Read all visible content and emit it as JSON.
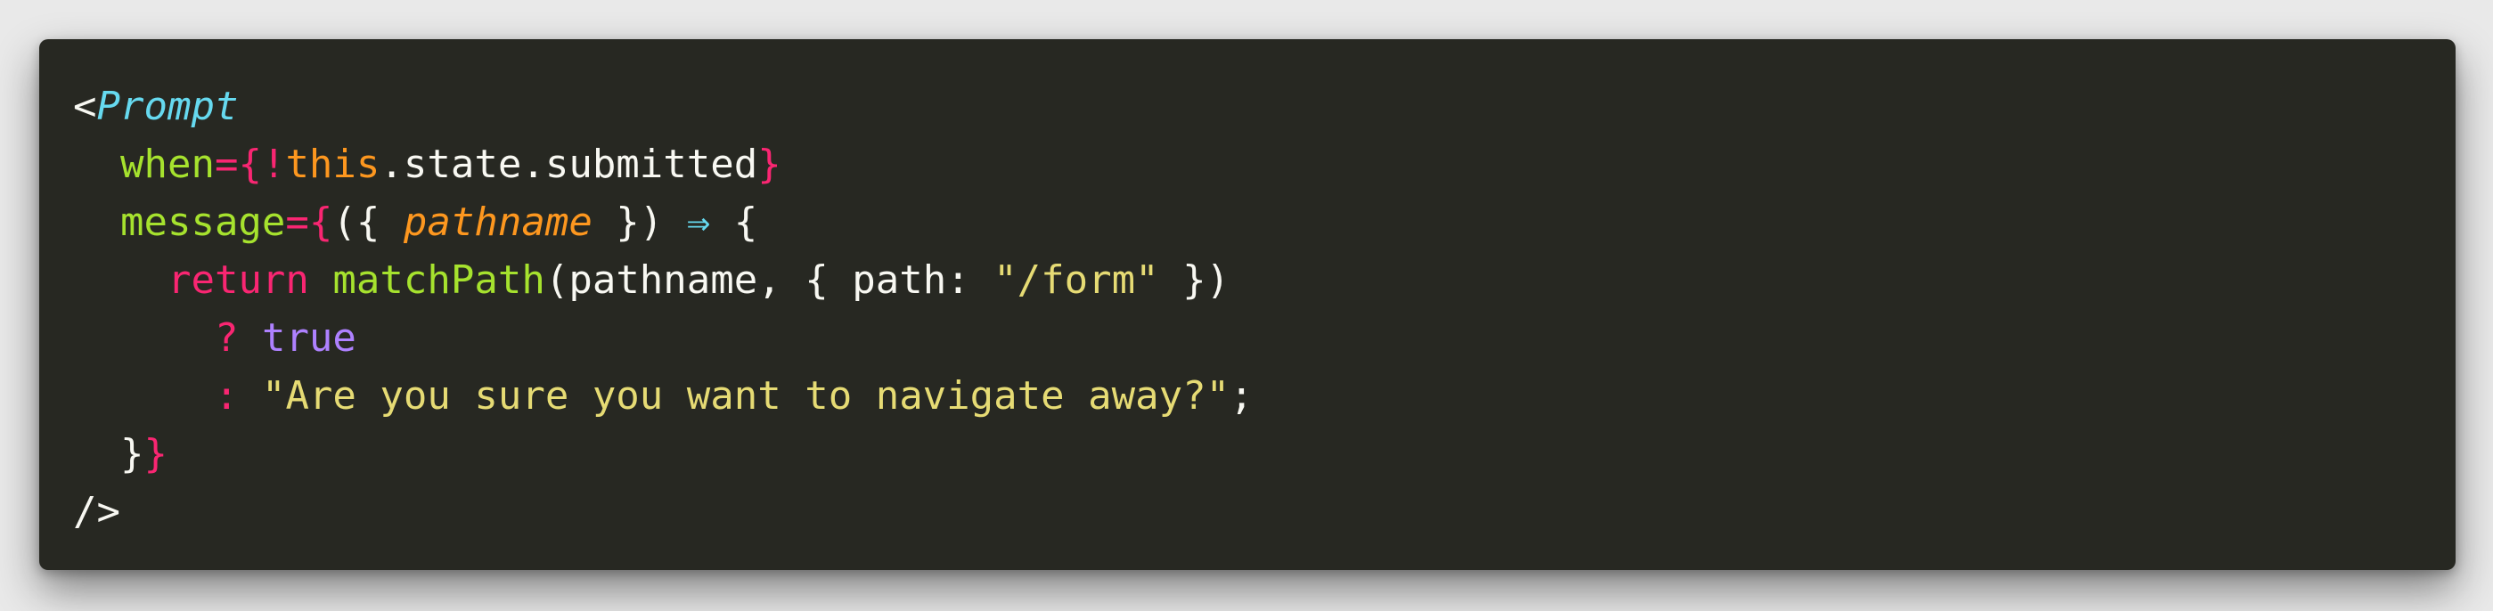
{
  "code": {
    "lines": [
      [
        {
          "t": "<",
          "c": "plain"
        },
        {
          "t": "Prompt",
          "c": "tag"
        }
      ],
      [
        {
          "t": "  ",
          "c": "plain"
        },
        {
          "t": "when",
          "c": "attr"
        },
        {
          "t": "={",
          "c": "op"
        },
        {
          "t": "!",
          "c": "op"
        },
        {
          "t": "this",
          "c": "kw-this"
        },
        {
          "t": ".state.submitted",
          "c": "plain"
        },
        {
          "t": "}",
          "c": "op"
        }
      ],
      [
        {
          "t": "  ",
          "c": "plain"
        },
        {
          "t": "message",
          "c": "attr"
        },
        {
          "t": "={",
          "c": "op"
        },
        {
          "t": "({ ",
          "c": "plain"
        },
        {
          "t": "pathname",
          "c": "param"
        },
        {
          "t": " }) ",
          "c": "plain"
        },
        {
          "t": "⇒",
          "c": "arrow"
        },
        {
          "t": " {",
          "c": "plain"
        }
      ],
      [
        {
          "t": "    ",
          "c": "plain"
        },
        {
          "t": "return",
          "c": "kw"
        },
        {
          "t": " ",
          "c": "plain"
        },
        {
          "t": "matchPath",
          "c": "fn"
        },
        {
          "t": "(pathname, { path: ",
          "c": "plain"
        },
        {
          "t": "\"/form\"",
          "c": "str"
        },
        {
          "t": " })",
          "c": "plain"
        }
      ],
      [
        {
          "t": "      ",
          "c": "plain"
        },
        {
          "t": "?",
          "c": "op"
        },
        {
          "t": " ",
          "c": "plain"
        },
        {
          "t": "true",
          "c": "bool"
        }
      ],
      [
        {
          "t": "      ",
          "c": "plain"
        },
        {
          "t": ":",
          "c": "op"
        },
        {
          "t": " ",
          "c": "plain"
        },
        {
          "t": "\"Are you sure you want to navigate away?\"",
          "c": "str"
        },
        {
          "t": ";",
          "c": "plain"
        }
      ],
      [
        {
          "t": "  ",
          "c": "plain"
        },
        {
          "t": "}",
          "c": "plain"
        },
        {
          "t": "}",
          "c": "op"
        }
      ],
      [
        {
          "t": "/>",
          "c": "plain"
        }
      ]
    ]
  }
}
